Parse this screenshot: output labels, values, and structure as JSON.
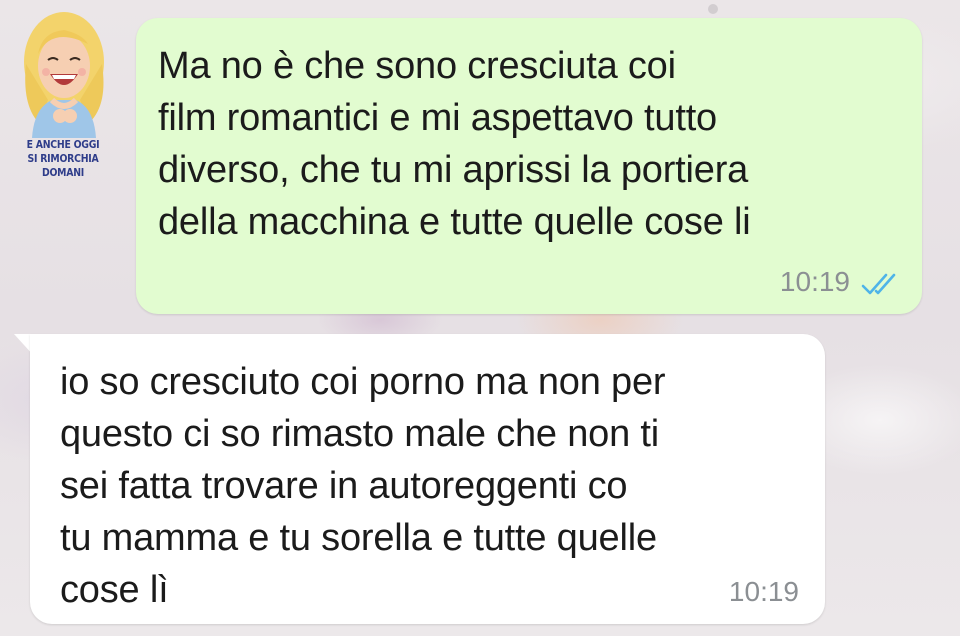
{
  "watermark": {
    "line1": "E ANCHE OGGI",
    "line2": "SI RIMORCHIA DOMANI"
  },
  "messages": [
    {
      "direction": "outgoing",
      "text": "Ma no è che sono cresciuta coi\nfilm romantici e mi aspettavo tutto\ndiverso, che tu mi aprissi la portiera\ndella macchina e tutte quelle cose li",
      "time": "10:19",
      "status_icon": "double-check-read-icon"
    },
    {
      "direction": "incoming",
      "text": "io so cresciuto coi porno ma non per\nquesto ci so rimasto male che non ti\nsei fatta trovare in autoreggenti co\ntu mamma e tu sorella e tutte quelle\ncose lì",
      "time": "10:19"
    }
  ],
  "colors": {
    "outgoing_bubble": "#e2fcd0",
    "incoming_bubble": "#ffffff",
    "read_ticks": "#4fb4e8",
    "timestamp": "#8b8f93"
  }
}
